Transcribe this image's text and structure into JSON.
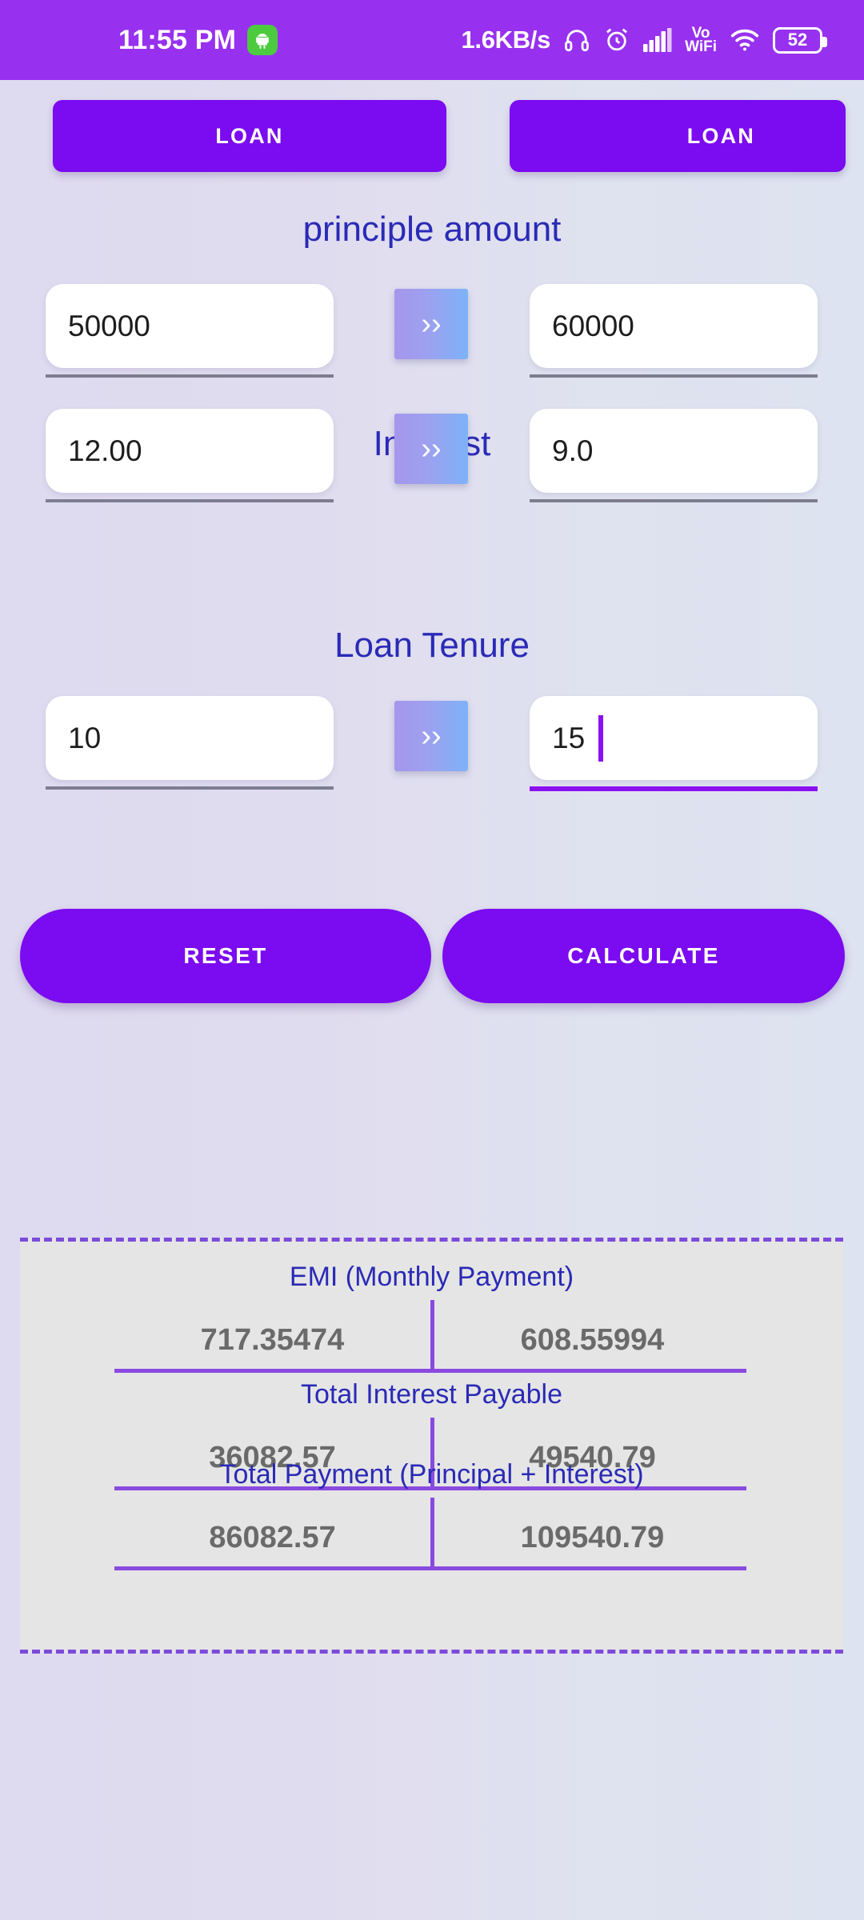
{
  "status_bar": {
    "time": "11:55 PM",
    "app_icon": "android-robot-icon",
    "network_speed": "1.6KB/s",
    "icons": [
      "headphones-icon",
      "alarm-clock-icon",
      "signal-bars-icon"
    ],
    "vowifi_line1": "Vo",
    "vowifi_line2": "WiFi",
    "wifi_icon": "wifi-icon",
    "battery_level": "52",
    "bg_color": "#9731ef"
  },
  "top_tabs": {
    "left_label": "LOAN",
    "right_label": "LOAN"
  },
  "sections": [
    {
      "title": "principle amount",
      "left_value": "50000",
      "right_value": "60000",
      "arrow_label": "››",
      "right_focused": false
    },
    {
      "title": "Interest",
      "left_value": "12.00",
      "right_value": "9.0",
      "arrow_label": "››",
      "right_focused": false
    },
    {
      "title": "Loan Tenure",
      "left_value": "10",
      "right_value": "15",
      "arrow_label": "››",
      "right_focused": true
    }
  ],
  "actions": {
    "reset_label": "RESET",
    "calculate_label": "CALCULATE"
  },
  "results": [
    {
      "label": "EMI  (Monthly Payment)",
      "value_a": "717.35474",
      "value_b": "608.55994"
    },
    {
      "label": "Total Interest Payable",
      "value_a": "36082.57",
      "value_b": "49540.79"
    },
    {
      "label": "Total Payment (Principal + Interest)",
      "value_a": "86082.57",
      "value_b": "109540.79"
    }
  ],
  "colors": {
    "accent_purple": "#7b0bf0",
    "status_bar": "#9731ef",
    "label_blue": "#2a2ab7",
    "divider": "#8a4ae0",
    "value_gray": "#6a6a6a"
  }
}
